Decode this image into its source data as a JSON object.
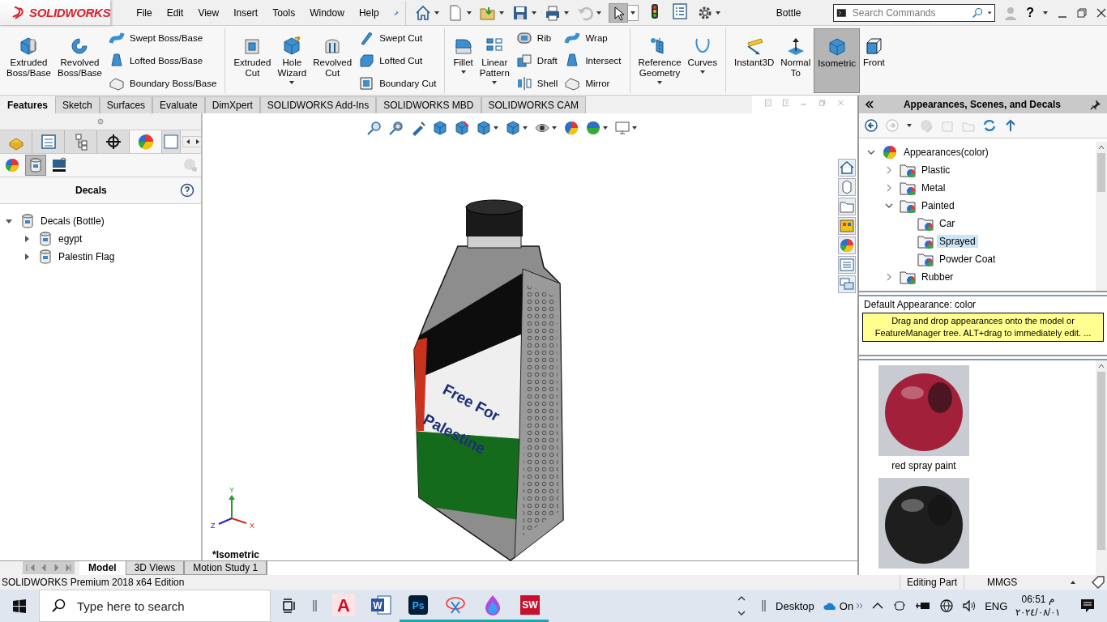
{
  "logo": {
    "text": "SOLIDWORKS"
  },
  "menu": [
    "File",
    "Edit",
    "View",
    "Insert",
    "Tools",
    "Window",
    "Help"
  ],
  "document_title": "Bottle",
  "search": {
    "placeholder": "Search Commands"
  },
  "help_label": "?",
  "ribbon": [
    {
      "commands": [
        {
          "kind": "large",
          "label": "Extruded\nBoss/Base",
          "dropdown": false,
          "selected": false
        },
        {
          "kind": "large",
          "label": "Revolved\nBoss/Base",
          "dropdown": false,
          "selected": false
        },
        {
          "kind": "stack",
          "items": [
            "Swept Boss/Base",
            "Lofted Boss/Base",
            "Boundary Boss/Base"
          ]
        }
      ]
    },
    {
      "commands": [
        {
          "kind": "large",
          "label": "Extruded\nCut",
          "dropdown": false,
          "selected": false
        },
        {
          "kind": "large",
          "label": "Hole\nWizard",
          "dropdown": true,
          "selected": false
        },
        {
          "kind": "large",
          "label": "Revolved\nCut",
          "dropdown": false,
          "selected": false
        },
        {
          "kind": "stack",
          "items": [
            "Swept Cut",
            "Lofted Cut",
            "Boundary Cut"
          ]
        }
      ]
    },
    {
      "commands": [
        {
          "kind": "large",
          "label": "Fillet",
          "dropdown": true,
          "selected": false
        },
        {
          "kind": "large",
          "label": "Linear\nPattern",
          "dropdown": true,
          "selected": false
        },
        {
          "kind": "stack",
          "items": [
            "Rib",
            "Draft",
            "Shell"
          ]
        },
        {
          "kind": "stack",
          "items": [
            "Wrap",
            "Intersect",
            "Mirror"
          ]
        }
      ]
    },
    {
      "commands": [
        {
          "kind": "large",
          "label": "Reference\nGeometry",
          "dropdown": true,
          "selected": false
        },
        {
          "kind": "large",
          "label": "Curves",
          "dropdown": true,
          "selected": false
        }
      ]
    },
    {
      "commands": [
        {
          "kind": "large",
          "label": "Instant3D",
          "dropdown": false,
          "selected": false
        },
        {
          "kind": "large",
          "label": "Normal\nTo",
          "dropdown": false,
          "selected": false
        },
        {
          "kind": "large",
          "label": "Isometric",
          "dropdown": false,
          "selected": true
        },
        {
          "kind": "large",
          "label": "Front",
          "dropdown": false,
          "selected": false
        }
      ]
    }
  ],
  "command_tabs": [
    {
      "label": "Features",
      "selected": true
    },
    {
      "label": "Sketch",
      "selected": false
    },
    {
      "label": "Surfaces",
      "selected": false
    },
    {
      "label": "Evaluate",
      "selected": false
    },
    {
      "label": "DimXpert",
      "selected": false
    },
    {
      "label": "SOLIDWORKS Add-Ins",
      "selected": false
    },
    {
      "label": "SOLIDWORKS MBD",
      "selected": false
    },
    {
      "label": "SOLIDWORKS CAM",
      "selected": false
    }
  ],
  "manager_tabs": [
    {
      "selected": false
    },
    {
      "selected": false
    },
    {
      "selected": false
    },
    {
      "selected": false
    },
    {
      "selected": true
    },
    {
      "selected": false
    }
  ],
  "manager_subtabs": [
    {
      "selected": false
    },
    {
      "selected": true
    },
    {
      "selected": false
    }
  ],
  "decals_panel": {
    "heading": "Decals",
    "tree": [
      {
        "label": "Decals (Bottle)",
        "expanded": true,
        "children": [
          {
            "label": "egypt",
            "expanded": false
          },
          {
            "label": "Palestin Flag",
            "expanded": false
          }
        ]
      }
    ]
  },
  "model": {
    "decal_text": [
      "Free For",
      "Palestine"
    ]
  },
  "triad": {
    "x": "X",
    "y": "Y",
    "z": "Z"
  },
  "view_label": "*Isometric",
  "bottom_tabs": [
    {
      "label": "Model",
      "selected": true
    },
    {
      "label": "3D Views",
      "selected": false
    },
    {
      "label": "Motion Study 1",
      "selected": false
    }
  ],
  "task_pane": {
    "title": "Appearances, Scenes, and Decals",
    "tree": [
      {
        "label": "Appearances(color)",
        "expanded": true,
        "selected": false,
        "children": [
          {
            "label": "Plastic",
            "expanded": false,
            "selected": false
          },
          {
            "label": "Metal",
            "expanded": false,
            "selected": false
          },
          {
            "label": "Painted",
            "expanded": true,
            "selected": false,
            "children": [
              {
                "label": "Car",
                "selected": false
              },
              {
                "label": "Sprayed",
                "selected": true
              },
              {
                "label": "Powder Coat",
                "selected": false
              }
            ]
          },
          {
            "label": "Rubber",
            "expanded": false,
            "selected": false
          }
        ]
      }
    ],
    "default_appearance": "Default Appearance: color",
    "tooltip": "Drag and drop appearances onto the model or FeatureManager tree.  ALT+drag to immediately edit. ...",
    "swatches": [
      {
        "label": "red spray paint",
        "color": "#a3203a"
      },
      {
        "color": "#1e1e1e"
      }
    ]
  },
  "status_bar": {
    "product": "SOLIDWORKS Premium 2018 x64 Edition",
    "mode": "Editing Part",
    "units": "MMGS"
  },
  "taskbar": {
    "search_placeholder": "Type here to search",
    "apps": [
      {
        "kind": "autocad",
        "text": "A",
        "running": false
      },
      {
        "kind": "word",
        "text": "W",
        "running": false
      },
      {
        "kind": "photoshop",
        "text": "Ps",
        "running": true
      },
      {
        "kind": "snip",
        "running": true
      },
      {
        "kind": "paint",
        "running": true
      },
      {
        "kind": "solidworks",
        "text": "SW",
        "running": true
      }
    ],
    "toolbar_label": "Desktop",
    "cloud_label": "On",
    "language": "ENG",
    "time": "06:51 م",
    "date": "٢٠٢٤/٠٨/٠١"
  }
}
